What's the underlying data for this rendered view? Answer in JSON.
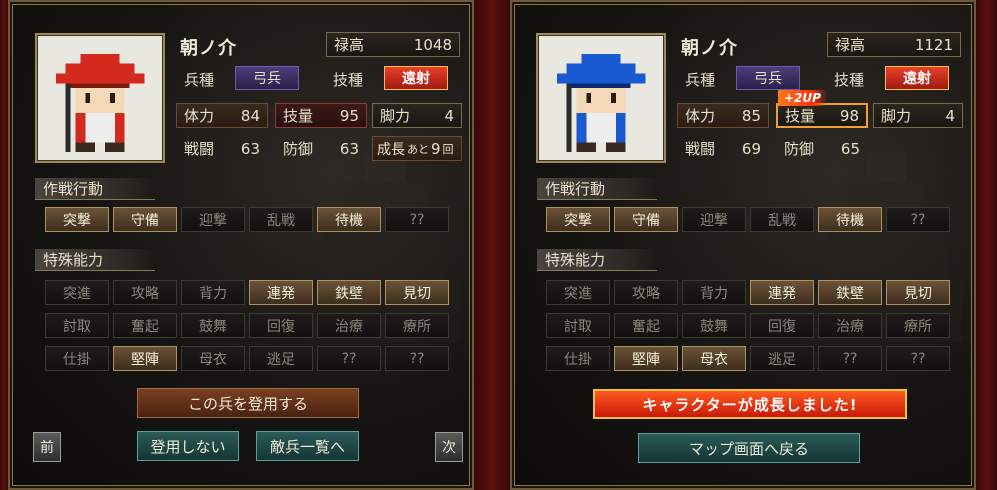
{
  "panels": [
    {
      "name": "朝ノ介",
      "stipend": {
        "label": "禄高",
        "value": "1048"
      },
      "unit_type": {
        "label": "兵種",
        "value": "弓兵"
      },
      "skill": {
        "label": "技種",
        "value": "遠射"
      },
      "stats": {
        "hp": {
          "label": "体力",
          "value": "84"
        },
        "skill_amount": {
          "label": "技量",
          "value": "95"
        },
        "legs": {
          "label": "脚力",
          "value": "4"
        },
        "combat": {
          "label": "戦闘",
          "value": "63"
        },
        "defense": {
          "label": "防御",
          "value": "63"
        },
        "growth": {
          "label": "成長",
          "suffix": "あと",
          "value": "9",
          "unit": "回"
        }
      },
      "tactics_title": "作戦行動",
      "tactics": [
        {
          "label": "突撃",
          "on": true
        },
        {
          "label": "守備",
          "on": true
        },
        {
          "label": "迎撃",
          "on": false
        },
        {
          "label": "乱戦",
          "on": false
        },
        {
          "label": "待機",
          "on": true
        },
        {
          "label": "??",
          "on": false
        }
      ],
      "special_title": "特殊能力",
      "special": [
        {
          "label": "突進",
          "on": false
        },
        {
          "label": "攻略",
          "on": false
        },
        {
          "label": "背力",
          "on": false
        },
        {
          "label": "連発",
          "on": true
        },
        {
          "label": "鉄壁",
          "on": true
        },
        {
          "label": "見切",
          "on": true
        },
        {
          "label": "討取",
          "on": false
        },
        {
          "label": "奮起",
          "on": false
        },
        {
          "label": "鼓舞",
          "on": false
        },
        {
          "label": "回復",
          "on": false
        },
        {
          "label": "治療",
          "on": false
        },
        {
          "label": "療所",
          "on": false
        },
        {
          "label": "仕掛",
          "on": false
        },
        {
          "label": "堅陣",
          "on": true
        },
        {
          "label": "母衣",
          "on": false
        },
        {
          "label": "逃足",
          "on": false
        },
        {
          "label": "??",
          "on": false
        },
        {
          "label": "??",
          "on": false
        }
      ],
      "actions": {
        "recruit": "この兵を登用する",
        "decline": "登用しない",
        "enemy_list": "敵兵一覧へ",
        "prev": "前",
        "next": "次"
      },
      "hat_color": "#d42a1e"
    },
    {
      "name": "朝ノ介",
      "stipend": {
        "label": "禄高",
        "value": "1121"
      },
      "unit_type": {
        "label": "兵種",
        "value": "弓兵"
      },
      "skill": {
        "label": "技種",
        "value": "遠射"
      },
      "up_badge": "+2UP",
      "stats": {
        "hp": {
          "label": "体力",
          "value": "85"
        },
        "skill_amount": {
          "label": "技量",
          "value": "98"
        },
        "legs": {
          "label": "脚力",
          "value": "4"
        },
        "combat": {
          "label": "戦闘",
          "value": "69"
        },
        "defense": {
          "label": "防御",
          "value": "65"
        }
      },
      "tactics_title": "作戦行動",
      "tactics": [
        {
          "label": "突撃",
          "on": true
        },
        {
          "label": "守備",
          "on": true
        },
        {
          "label": "迎撃",
          "on": false
        },
        {
          "label": "乱戦",
          "on": false
        },
        {
          "label": "待機",
          "on": true
        },
        {
          "label": "??",
          "on": false
        }
      ],
      "special_title": "特殊能力",
      "special": [
        {
          "label": "突進",
          "on": false
        },
        {
          "label": "攻略",
          "on": false
        },
        {
          "label": "背力",
          "on": false
        },
        {
          "label": "連発",
          "on": true
        },
        {
          "label": "鉄壁",
          "on": true
        },
        {
          "label": "見切",
          "on": true
        },
        {
          "label": "討取",
          "on": false
        },
        {
          "label": "奮起",
          "on": false
        },
        {
          "label": "鼓舞",
          "on": false
        },
        {
          "label": "回復",
          "on": false
        },
        {
          "label": "治療",
          "on": false
        },
        {
          "label": "療所",
          "on": false
        },
        {
          "label": "仕掛",
          "on": false
        },
        {
          "label": "堅陣",
          "on": true
        },
        {
          "label": "母衣",
          "on": true
        },
        {
          "label": "逃足",
          "on": false
        },
        {
          "label": "??",
          "on": false
        },
        {
          "label": "??",
          "on": false
        }
      ],
      "banner": "キャラクターが成長しました!",
      "return_btn": "マップ画面へ戻る",
      "hat_color": "#1a5ad0"
    }
  ]
}
